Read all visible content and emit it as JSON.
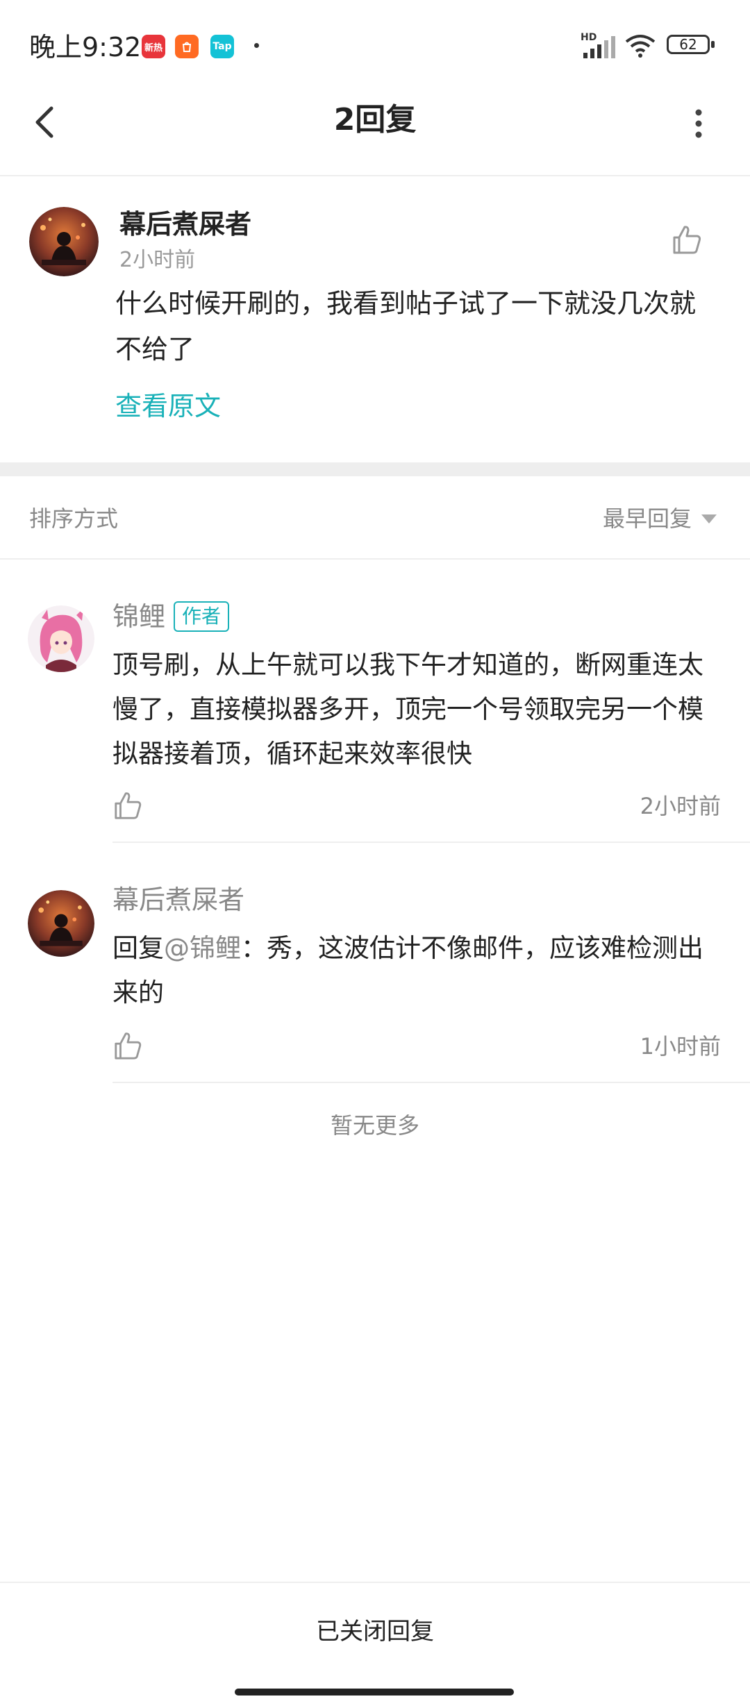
{
  "status_bar": {
    "time": "晚上9:32",
    "apps": [
      {
        "icon": "news-app-icon",
        "label": "新热",
        "color": "#e8353b"
      },
      {
        "icon": "mi-store-icon",
        "label": "",
        "color": "#ff6a22"
      },
      {
        "icon": "taptap-icon",
        "label": "Tap",
        "color": "#14c2d6"
      }
    ],
    "network_label": "HD",
    "battery": "62"
  },
  "nav": {
    "title": "2回复"
  },
  "post": {
    "author": "幕后煮屎者",
    "time": "2小时前",
    "text": "什么时候开刷的，我看到帖子试了一下就没几次就不给了",
    "view_original": "查看原文"
  },
  "sort": {
    "label": "排序方式",
    "value": "最早回复"
  },
  "replies": [
    {
      "author": "锦鲤",
      "badge": "作者",
      "text": "顶号刷，从上午就可以我下午才知道的，断网重连太慢了，直接模拟器多开，顶完一个号领取完另一个模拟器接着顶，循环起来效率很快",
      "time": "2小时前"
    },
    {
      "author": "幕后煮屎者",
      "reply_prefix": "回复",
      "mention": "@锦鲤",
      "text": "：秀，这波估计不像邮件，应该难检测出来的",
      "time": "1小时前"
    }
  ],
  "empty_more": "暂无更多",
  "closed_reply": "已关闭回复",
  "colors": {
    "accent": "#19b1b8",
    "divider": "#eeeeee",
    "muted_text": "#888888"
  }
}
